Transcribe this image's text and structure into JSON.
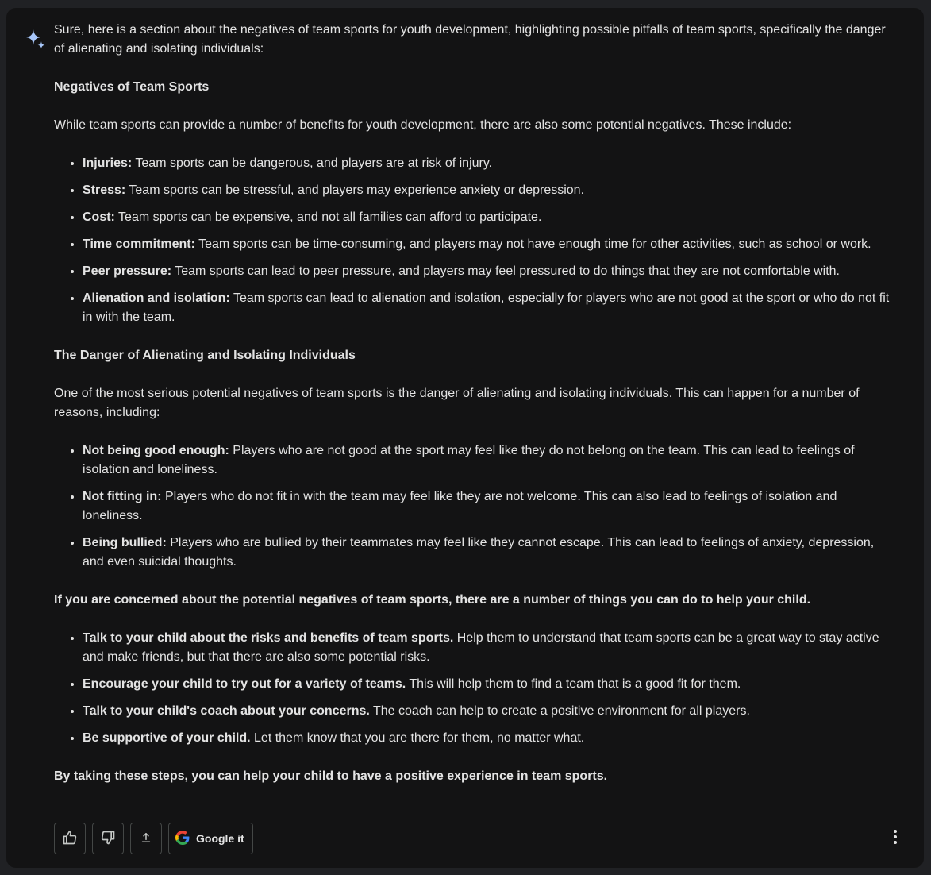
{
  "response": {
    "intro": "Sure, here is a section about the negatives of team sports for youth development, highlighting possible pitfalls of team sports, specifically the danger of alienating and isolating individuals:",
    "heading1": "Negatives of Team Sports",
    "para1": "While team sports can provide a number of benefits for youth development, there are also some potential negatives. These include:",
    "list1": [
      {
        "term": "Injuries:",
        "text": " Team sports can be dangerous, and players are at risk of injury."
      },
      {
        "term": "Stress:",
        "text": " Team sports can be stressful, and players may experience anxiety or depression."
      },
      {
        "term": "Cost:",
        "text": " Team sports can be expensive, and not all families can afford to participate."
      },
      {
        "term": "Time commitment:",
        "text": " Team sports can be time-consuming, and players may not have enough time for other activities, such as school or work."
      },
      {
        "term": "Peer pressure:",
        "text": " Team sports can lead to peer pressure, and players may feel pressured to do things that they are not comfortable with."
      },
      {
        "term": "Alienation and isolation:",
        "text": " Team sports can lead to alienation and isolation, especially for players who are not good at the sport or who do not fit in with the team."
      }
    ],
    "heading2": "The Danger of Alienating and Isolating Individuals",
    "para2": "One of the most serious potential negatives of team sports is the danger of alienating and isolating individuals. This can happen for a number of reasons, including:",
    "list2": [
      {
        "term": "Not being good enough:",
        "text": " Players who are not good at the sport may feel like they do not belong on the team. This can lead to feelings of isolation and loneliness."
      },
      {
        "term": "Not fitting in:",
        "text": " Players who do not fit in with the team may feel like they are not welcome. This can also lead to feelings of isolation and loneliness."
      },
      {
        "term": "Being bullied:",
        "text": " Players who are bullied by their teammates may feel like they cannot escape. This can lead to feelings of anxiety, depression, and even suicidal thoughts."
      }
    ],
    "para3": "If you are concerned about the potential negatives of team sports, there are a number of things you can do to help your child.",
    "list3": [
      {
        "term": "Talk to your child about the risks and benefits of team sports.",
        "text": " Help them to understand that team sports can be a great way to stay active and make friends, but that there are also some potential risks."
      },
      {
        "term": "Encourage your child to try out for a variety of teams.",
        "text": " This will help them to find a team that is a good fit for them."
      },
      {
        "term": "Talk to your child's coach about your concerns.",
        "text": " The coach can help to create a positive environment for all players."
      },
      {
        "term": "Be supportive of your child.",
        "text": " Let them know that you are there for them, no matter what."
      }
    ],
    "closing": "By taking these steps, you can help your child to have a positive experience in team sports."
  },
  "actions": {
    "google_label": "Google it",
    "icons": [
      "thumbs-up-icon",
      "thumbs-down-icon",
      "share-icon",
      "google-logo-icon",
      "more-vert-icon"
    ]
  },
  "colors": {
    "page_bg": "#202124",
    "card_bg": "#131314",
    "text": "#e3e3e3",
    "button_border": "#444746",
    "spark_accent": "#a8c7fa"
  }
}
